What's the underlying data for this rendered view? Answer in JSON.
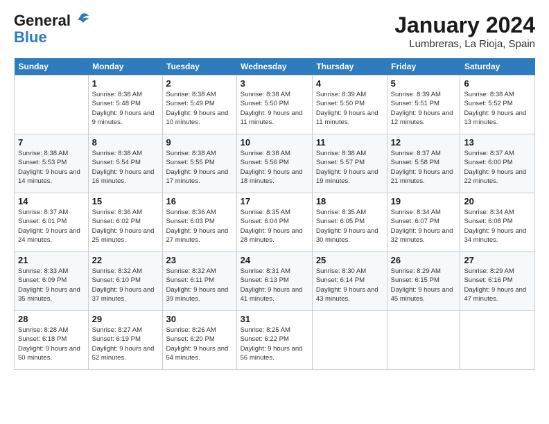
{
  "header": {
    "logo_line1": "General",
    "logo_line2": "Blue",
    "title": "January 2024",
    "subtitle": "Lumbreras, La Rioja, Spain"
  },
  "days_of_week": [
    "Sunday",
    "Monday",
    "Tuesday",
    "Wednesday",
    "Thursday",
    "Friday",
    "Saturday"
  ],
  "weeks": [
    [
      {
        "date": "",
        "sunrise": "",
        "sunset": "",
        "daylight": ""
      },
      {
        "date": "1",
        "sunrise": "Sunrise: 8:38 AM",
        "sunset": "Sunset: 5:48 PM",
        "daylight": "Daylight: 9 hours and 9 minutes."
      },
      {
        "date": "2",
        "sunrise": "Sunrise: 8:38 AM",
        "sunset": "Sunset: 5:49 PM",
        "daylight": "Daylight: 9 hours and 10 minutes."
      },
      {
        "date": "3",
        "sunrise": "Sunrise: 8:38 AM",
        "sunset": "Sunset: 5:50 PM",
        "daylight": "Daylight: 9 hours and 11 minutes."
      },
      {
        "date": "4",
        "sunrise": "Sunrise: 8:39 AM",
        "sunset": "Sunset: 5:50 PM",
        "daylight": "Daylight: 9 hours and 11 minutes."
      },
      {
        "date": "5",
        "sunrise": "Sunrise: 8:39 AM",
        "sunset": "Sunset: 5:51 PM",
        "daylight": "Daylight: 9 hours and 12 minutes."
      },
      {
        "date": "6",
        "sunrise": "Sunrise: 8:38 AM",
        "sunset": "Sunset: 5:52 PM",
        "daylight": "Daylight: 9 hours and 13 minutes."
      }
    ],
    [
      {
        "date": "7",
        "sunrise": "Sunrise: 8:38 AM",
        "sunset": "Sunset: 5:53 PM",
        "daylight": "Daylight: 9 hours and 14 minutes."
      },
      {
        "date": "8",
        "sunrise": "Sunrise: 8:38 AM",
        "sunset": "Sunset: 5:54 PM",
        "daylight": "Daylight: 9 hours and 16 minutes."
      },
      {
        "date": "9",
        "sunrise": "Sunrise: 8:38 AM",
        "sunset": "Sunset: 5:55 PM",
        "daylight": "Daylight: 9 hours and 17 minutes."
      },
      {
        "date": "10",
        "sunrise": "Sunrise: 8:38 AM",
        "sunset": "Sunset: 5:56 PM",
        "daylight": "Daylight: 9 hours and 18 minutes."
      },
      {
        "date": "11",
        "sunrise": "Sunrise: 8:38 AM",
        "sunset": "Sunset: 5:57 PM",
        "daylight": "Daylight: 9 hours and 19 minutes."
      },
      {
        "date": "12",
        "sunrise": "Sunrise: 8:37 AM",
        "sunset": "Sunset: 5:58 PM",
        "daylight": "Daylight: 9 hours and 21 minutes."
      },
      {
        "date": "13",
        "sunrise": "Sunrise: 8:37 AM",
        "sunset": "Sunset: 6:00 PM",
        "daylight": "Daylight: 9 hours and 22 minutes."
      }
    ],
    [
      {
        "date": "14",
        "sunrise": "Sunrise: 8:37 AM",
        "sunset": "Sunset: 6:01 PM",
        "daylight": "Daylight: 9 hours and 24 minutes."
      },
      {
        "date": "15",
        "sunrise": "Sunrise: 8:36 AM",
        "sunset": "Sunset: 6:02 PM",
        "daylight": "Daylight: 9 hours and 25 minutes."
      },
      {
        "date": "16",
        "sunrise": "Sunrise: 8:36 AM",
        "sunset": "Sunset: 6:03 PM",
        "daylight": "Daylight: 9 hours and 27 minutes."
      },
      {
        "date": "17",
        "sunrise": "Sunrise: 8:35 AM",
        "sunset": "Sunset: 6:04 PM",
        "daylight": "Daylight: 9 hours and 28 minutes."
      },
      {
        "date": "18",
        "sunrise": "Sunrise: 8:35 AM",
        "sunset": "Sunset: 6:05 PM",
        "daylight": "Daylight: 9 hours and 30 minutes."
      },
      {
        "date": "19",
        "sunrise": "Sunrise: 8:34 AM",
        "sunset": "Sunset: 6:07 PM",
        "daylight": "Daylight: 9 hours and 32 minutes."
      },
      {
        "date": "20",
        "sunrise": "Sunrise: 8:34 AM",
        "sunset": "Sunset: 6:08 PM",
        "daylight": "Daylight: 9 hours and 34 minutes."
      }
    ],
    [
      {
        "date": "21",
        "sunrise": "Sunrise: 8:33 AM",
        "sunset": "Sunset: 6:09 PM",
        "daylight": "Daylight: 9 hours and 35 minutes."
      },
      {
        "date": "22",
        "sunrise": "Sunrise: 8:32 AM",
        "sunset": "Sunset: 6:10 PM",
        "daylight": "Daylight: 9 hours and 37 minutes."
      },
      {
        "date": "23",
        "sunrise": "Sunrise: 8:32 AM",
        "sunset": "Sunset: 6:11 PM",
        "daylight": "Daylight: 9 hours and 39 minutes."
      },
      {
        "date": "24",
        "sunrise": "Sunrise: 8:31 AM",
        "sunset": "Sunset: 6:13 PM",
        "daylight": "Daylight: 9 hours and 41 minutes."
      },
      {
        "date": "25",
        "sunrise": "Sunrise: 8:30 AM",
        "sunset": "Sunset: 6:14 PM",
        "daylight": "Daylight: 9 hours and 43 minutes."
      },
      {
        "date": "26",
        "sunrise": "Sunrise: 8:29 AM",
        "sunset": "Sunset: 6:15 PM",
        "daylight": "Daylight: 9 hours and 45 minutes."
      },
      {
        "date": "27",
        "sunrise": "Sunrise: 8:29 AM",
        "sunset": "Sunset: 6:16 PM",
        "daylight": "Daylight: 9 hours and 47 minutes."
      }
    ],
    [
      {
        "date": "28",
        "sunrise": "Sunrise: 8:28 AM",
        "sunset": "Sunset: 6:18 PM",
        "daylight": "Daylight: 9 hours and 50 minutes."
      },
      {
        "date": "29",
        "sunrise": "Sunrise: 8:27 AM",
        "sunset": "Sunset: 6:19 PM",
        "daylight": "Daylight: 9 hours and 52 minutes."
      },
      {
        "date": "30",
        "sunrise": "Sunrise: 8:26 AM",
        "sunset": "Sunset: 6:20 PM",
        "daylight": "Daylight: 9 hours and 54 minutes."
      },
      {
        "date": "31",
        "sunrise": "Sunrise: 8:25 AM",
        "sunset": "Sunset: 6:22 PM",
        "daylight": "Daylight: 9 hours and 56 minutes."
      },
      {
        "date": "",
        "sunrise": "",
        "sunset": "",
        "daylight": ""
      },
      {
        "date": "",
        "sunrise": "",
        "sunset": "",
        "daylight": ""
      },
      {
        "date": "",
        "sunrise": "",
        "sunset": "",
        "daylight": ""
      }
    ]
  ]
}
